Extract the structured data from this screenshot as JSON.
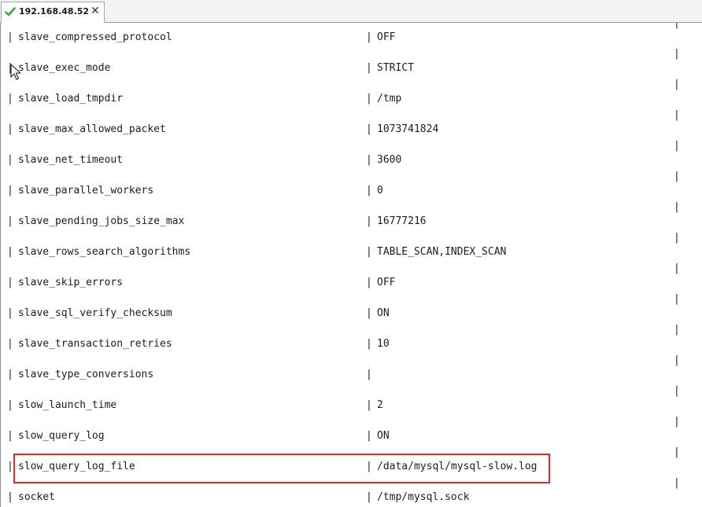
{
  "tab": {
    "title": "192.168.48.52",
    "close_label": "✕",
    "status_icon": "check-icon"
  },
  "terminal": {
    "rows": [
      {
        "name": "slave_compressed_protocol",
        "value": "OFF"
      },
      {
        "name": "slave_exec_mode",
        "value": "STRICT"
      },
      {
        "name": "slave_load_tmpdir",
        "value": "/tmp"
      },
      {
        "name": "slave_max_allowed_packet",
        "value": "1073741824"
      },
      {
        "name": "slave_net_timeout",
        "value": "3600"
      },
      {
        "name": "slave_parallel_workers",
        "value": "0"
      },
      {
        "name": "slave_pending_jobs_size_max",
        "value": "16777216"
      },
      {
        "name": "slave_rows_search_algorithms",
        "value": "TABLE_SCAN,INDEX_SCAN"
      },
      {
        "name": "slave_skip_errors",
        "value": "OFF"
      },
      {
        "name": "slave_sql_verify_checksum",
        "value": "ON"
      },
      {
        "name": "slave_transaction_retries",
        "value": "10"
      },
      {
        "name": "slave_type_conversions",
        "value": ""
      },
      {
        "name": "slow_launch_time",
        "value": "2"
      },
      {
        "name": "slow_query_log",
        "value": "ON"
      },
      {
        "name": "slow_query_log_file",
        "value": "/data/mysql/mysql-slow.log"
      },
      {
        "name": "socket",
        "value": "/tmp/mysql.sock"
      }
    ],
    "pipe": "|",
    "highlight_color": "#e0292a"
  }
}
